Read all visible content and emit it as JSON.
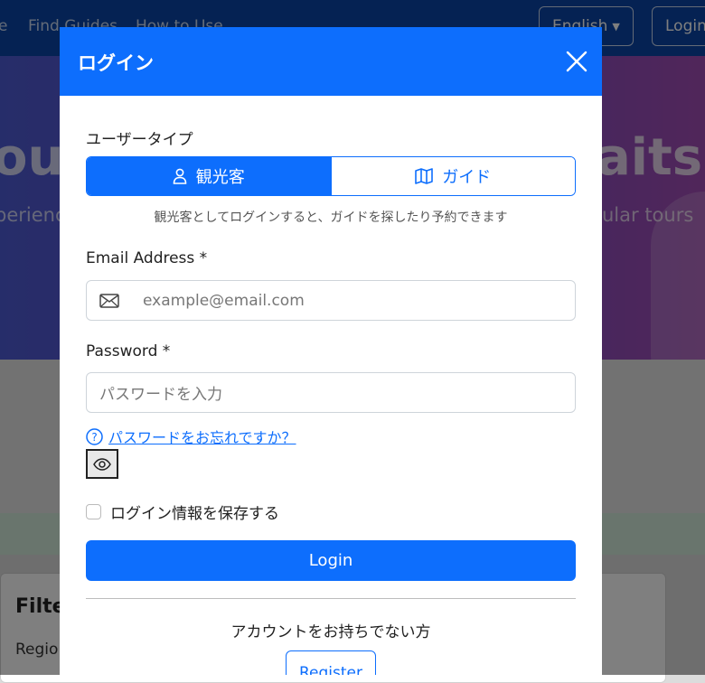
{
  "background": {
    "nav": {
      "home_fragment": "e",
      "find_guides": "Find Guides",
      "how_to_use": "How to Use",
      "language": "English",
      "login": "Login"
    },
    "hero": {
      "title_left": "ou",
      "title_right": "aits",
      "subtitle_left": "perienc",
      "subtitle_right": "ular tours"
    },
    "filter": {
      "title": "Filter",
      "region": "Regio"
    }
  },
  "modal": {
    "title": "ログイン",
    "user_type_label": "ユーザータイプ",
    "user_types": [
      {
        "label": "観光客",
        "icon": "person-icon",
        "active": true
      },
      {
        "label": "ガイド",
        "icon": "map-icon",
        "active": false
      }
    ],
    "user_type_hint": "観光客としてログインすると、ガイドを探したり予約できます",
    "email": {
      "label": "Email Address *",
      "placeholder": "example@email.com",
      "icon": "envelope-icon"
    },
    "password": {
      "label": "Password *",
      "placeholder": "パスワードを入力"
    },
    "forgot_password": "パスワードをお忘れですか？",
    "remember_me": "ログイン情報を保存する",
    "login_button": "Login",
    "no_account": "アカウントをお持ちでない方",
    "register_button": "Register"
  },
  "colors": {
    "primary": "#0d6efd",
    "navbar": "#0a45a6"
  }
}
